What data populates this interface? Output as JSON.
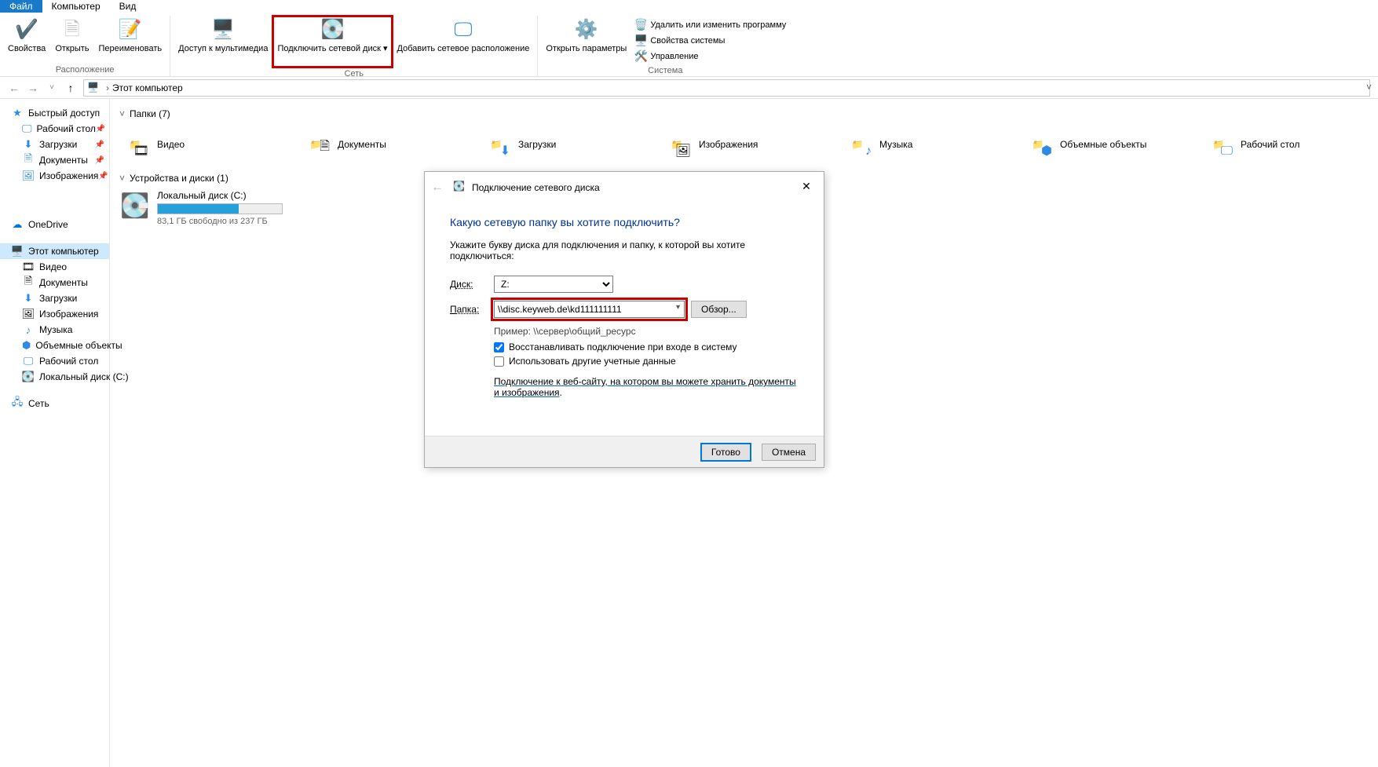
{
  "menu": {
    "file": "Файл",
    "computer": "Компьютер",
    "view": "Вид"
  },
  "ribbon": {
    "location": {
      "properties": "Свойства",
      "open": "Открыть",
      "rename": "Переименовать",
      "groupLabel": "Расположение"
    },
    "network": {
      "media": "Доступ к мультимедиа",
      "mapDrive": "Подключить сетевой диск",
      "addLocation": "Добавить сетевое расположение",
      "groupLabel": "Сеть"
    },
    "system": {
      "settings": "Открыть параметры",
      "uninstall": "Удалить или изменить программу",
      "props": "Свойства системы",
      "manage": "Управление",
      "groupLabel": "Система"
    }
  },
  "breadcrumb": {
    "root": "Этот компьютер"
  },
  "sidebar": {
    "quick": "Быстрый доступ",
    "quickItems": [
      {
        "label": "Рабочий стол"
      },
      {
        "label": "Загрузки"
      },
      {
        "label": "Документы"
      },
      {
        "label": "Изображения"
      }
    ],
    "onedrive": "OneDrive",
    "thispc": "Этот компьютер",
    "pcItems": [
      {
        "label": "Видео"
      },
      {
        "label": "Документы"
      },
      {
        "label": "Загрузки"
      },
      {
        "label": "Изображения"
      },
      {
        "label": "Музыка"
      },
      {
        "label": "Объемные объекты"
      },
      {
        "label": "Рабочий стол"
      },
      {
        "label": "Локальный диск (C:)"
      }
    ],
    "network": "Сеть"
  },
  "content": {
    "foldersHdr": "Папки (7)",
    "folders": [
      {
        "label": "Видео"
      },
      {
        "label": "Документы"
      },
      {
        "label": "Загрузки"
      },
      {
        "label": "Изображения"
      },
      {
        "label": "Музыка"
      },
      {
        "label": "Объемные объекты"
      },
      {
        "label": "Рабочий стол"
      }
    ],
    "drivesHdr": "Устройства и диски (1)",
    "drive": {
      "label": "Локальный диск (C:)",
      "free": "83,1 ГБ свободно из 237 ГБ",
      "usedPct": 65
    }
  },
  "dialog": {
    "title": "Подключение сетевого диска",
    "heading": "Какую сетевую папку вы хотите подключить?",
    "instr": "Укажите букву диска для подключения и папку, к которой вы хотите подключиться:",
    "driveLbl": "Диск:",
    "driveVal": "Z:",
    "folderLbl": "Папка:",
    "folderVal": "\\\\disc.keyweb.de\\kd111111111",
    "browse": "Обзор...",
    "example": "Пример: \\\\сервер\\общий_ресурс",
    "reconnect": "Восстанавливать подключение при входе в систему",
    "otherCreds": "Использовать другие учетные данные",
    "link": "Подключение к веб-сайту, на котором вы можете хранить документы и изображения",
    "finish": "Готово",
    "cancel": "Отмена"
  }
}
